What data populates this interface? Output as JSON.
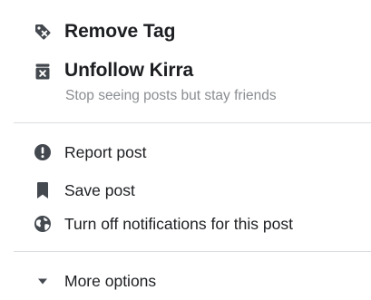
{
  "menu": {
    "remove_tag": {
      "label": "Remove Tag",
      "icon": "tag-remove-icon"
    },
    "unfollow": {
      "label": "Unfollow Kirra",
      "sublabel": "Stop seeing posts but stay friends",
      "icon": "unfollow-icon"
    },
    "report": {
      "label": "Report post",
      "icon": "alert-icon"
    },
    "save": {
      "label": "Save post",
      "icon": "bookmark-icon"
    },
    "notifications": {
      "label": "Turn off notifications for this post",
      "icon": "globe-icon"
    },
    "more": {
      "label": "More options",
      "icon": "caret-down-icon"
    }
  },
  "colors": {
    "text": "#1c1e21",
    "icon": "#444950",
    "subtext": "#8a8d91",
    "divider": "#dadde1"
  }
}
